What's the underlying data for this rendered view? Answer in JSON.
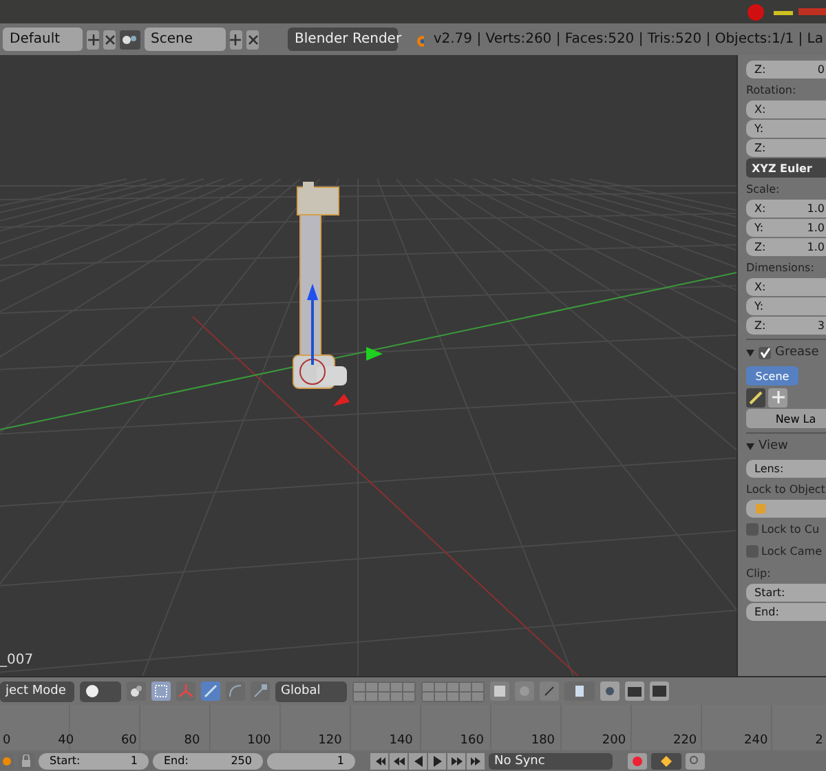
{
  "info_header": {
    "screen_layout": "Default",
    "scene": "Scene",
    "render_engine": "Blender Render",
    "stats": "v2.79 | Verts:260 | Faces:520 | Tris:520 | Objects:1/1 | La"
  },
  "viewport": {
    "object_name": "_007"
  },
  "properties_panel": {
    "items": [
      {
        "kind": "field",
        "label": "Z:",
        "value": "0"
      },
      {
        "kind": "label",
        "text": "Rotation:"
      },
      {
        "kind": "field",
        "label": "X:"
      },
      {
        "kind": "field",
        "label": "Y:"
      },
      {
        "kind": "field",
        "label": "Z:"
      },
      {
        "kind": "dropdown",
        "text": "XYZ Euler"
      },
      {
        "kind": "label",
        "text": "Scale:"
      },
      {
        "kind": "field",
        "label": "X:",
        "value": "1.0"
      },
      {
        "kind": "field",
        "label": "Y:",
        "value": "1.0"
      },
      {
        "kind": "field",
        "label": "Z:",
        "value": "1.0"
      },
      {
        "kind": "label",
        "text": "Dimensions:"
      },
      {
        "kind": "field",
        "label": "X:"
      },
      {
        "kind": "field",
        "label": "Y:"
      },
      {
        "kind": "field",
        "label": "Z:",
        "value": "3"
      },
      {
        "kind": "section",
        "text": "Grease",
        "expanded": true,
        "checked": true
      },
      {
        "kind": "tab",
        "text": "Scene",
        "selected": true
      },
      {
        "kind": "tools"
      },
      {
        "kind": "button",
        "text": "New La"
      },
      {
        "kind": "section",
        "text": "View",
        "expanded": true
      },
      {
        "kind": "field",
        "label": "Lens:"
      },
      {
        "kind": "label",
        "text": "Lock to Object"
      },
      {
        "kind": "object"
      },
      {
        "kind": "checkbox",
        "text": "Lock to Cu",
        "checked": false
      },
      {
        "kind": "checkbox",
        "text": "Lock Came",
        "checked": false
      },
      {
        "kind": "label",
        "text": "Clip:"
      },
      {
        "kind": "field",
        "label": "Start:"
      },
      {
        "kind": "field",
        "label": "End:"
      }
    ]
  },
  "view3d_header": {
    "mode": "ject Mode",
    "orientation": "Global",
    "manipulators": [
      {
        "kind": "combo",
        "selected": false
      },
      {
        "kind": "translate",
        "selected": true
      },
      {
        "kind": "rotate",
        "selected": false
      },
      {
        "kind": "scale",
        "selected": false
      }
    ]
  },
  "timeline": {
    "ruler": [
      "0",
      "40",
      "60",
      "80",
      "100",
      "120",
      "140",
      "160",
      "180",
      "200",
      "220",
      "240",
      "2"
    ]
  },
  "playback_bar": {
    "start_label": "Start:",
    "start": "1",
    "end_label": "End:",
    "end": "250",
    "current_frame": "1",
    "sync": "No Sync"
  }
}
